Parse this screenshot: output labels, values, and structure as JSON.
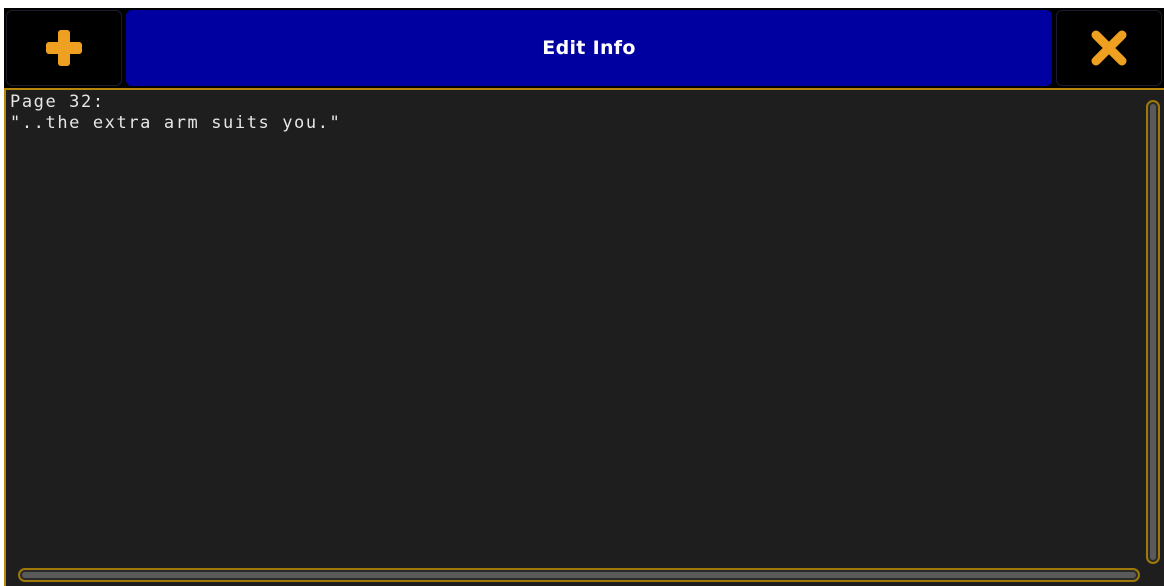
{
  "dialog": {
    "title": "Edit Info",
    "add_icon": "plus-icon",
    "close_icon": "close-icon"
  },
  "editor": {
    "lines": [
      "Page 32:",
      "\"..the extra arm suits you.\""
    ]
  },
  "colors": {
    "title_bar": "#0000a0",
    "icon_accent": "#f0a020",
    "border_accent": "#b8860b",
    "text": "#e6e6e6",
    "editor_background": "#1e1e1e"
  }
}
